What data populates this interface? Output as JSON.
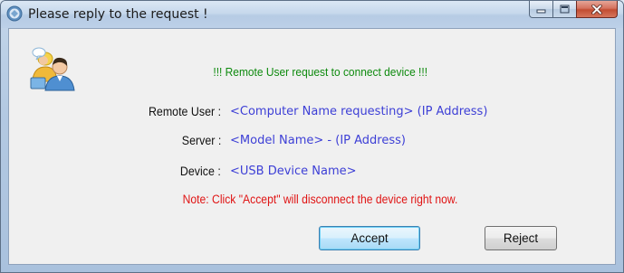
{
  "window": {
    "title": "Please reply to the request !",
    "icons": {
      "app": "app-icon",
      "minimize": "minimize-icon",
      "maximize": "maximize-icon",
      "close": "close-icon",
      "users": "remote-user-icon"
    }
  },
  "dialog": {
    "headline": "!!! Remote User request to connect device !!!",
    "fields": [
      {
        "label": "Remote User :",
        "value": "<Computer Name requesting> (IP Address)"
      },
      {
        "label": "Server :",
        "value": "<Model Name> - (IP Address)"
      },
      {
        "label": "Device :",
        "value": "<USB Device Name>"
      }
    ],
    "note": "Note: Click \"Accept\" will disconnect the device right now.",
    "accept_label": "Accept",
    "reject_label": "Reject"
  },
  "colors": {
    "headline": "#0d8a0d",
    "value_text": "#3d3fd6",
    "note_text": "#e01414",
    "close_button": "#c24d32"
  }
}
